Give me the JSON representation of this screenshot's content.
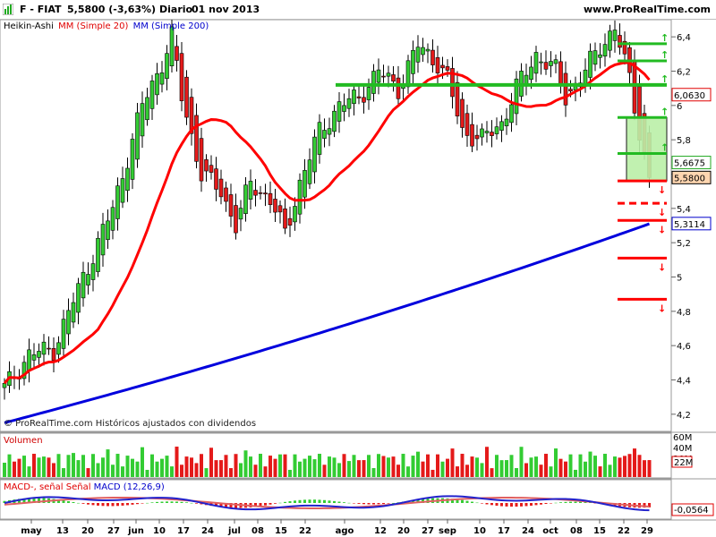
{
  "header": {
    "symbol": "F - FIAT",
    "quote": "5,5800 (-3,63%)",
    "period": "Diario",
    "date": "01 nov 2013",
    "site": "www.ProRealTime.com"
  },
  "legend": {
    "candle_type": "Heikin-Ashi",
    "ma1_label": "MM (Simple 20)",
    "ma2_label": "MM (Simple 200)"
  },
  "footnote": "© ProRealTime.com Históricos ajustados con dividendos",
  "volume_panel": {
    "title": "Volumen",
    "ticks": [
      "60M",
      "40M",
      "20M"
    ],
    "last_value_tag": "22M"
  },
  "macd_panel": {
    "title_prefix": "MACD-, señal Señal ",
    "title_params": "MACD (12,26,9)",
    "value_tag": "-0,0564"
  },
  "colors": {
    "up_candle": "#33cc33",
    "down_candle": "#e41a1a",
    "ma20": "#ff0000",
    "ma200": "#0000dd",
    "support": "#ff0000",
    "resistance": "#22bb22",
    "macd_line": "#2222cc",
    "signal_line": "#e06060"
  },
  "chart_data": {
    "type": "candlestick",
    "title": "F - FIAT",
    "y_axis": {
      "ticks": [
        "6,4",
        "6,2",
        "6",
        "5,8",
        "5,6",
        "5,4",
        "5,2",
        "5",
        "4,8",
        "4,6",
        "4,4",
        "4,2"
      ],
      "min": 4.1,
      "max": 6.5
    },
    "x_axis": {
      "labels": [
        "may",
        "13",
        "20",
        "27",
        "jun",
        "10",
        "17",
        "24",
        "jul",
        "08",
        "15",
        "22",
        "ago",
        "12",
        "20",
        "27",
        "sep",
        "10",
        "17",
        "24",
        "oct",
        "08",
        "15",
        "22",
        "29"
      ]
    },
    "price_tags": [
      {
        "label": "6,0630",
        "kind": "ma20"
      },
      {
        "label": "5,6675",
        "kind": "level"
      },
      {
        "label": "5,5800",
        "kind": "last"
      },
      {
        "label": "5,3114",
        "kind": "ma200"
      }
    ],
    "resistance_levels": [
      6.36,
      6.26,
      6.12,
      5.93,
      5.72
    ],
    "support_levels": [
      5.56,
      5.43,
      5.33,
      5.11,
      4.87
    ],
    "candles_summary": {
      "count": 132,
      "start": 4.35,
      "peak": 6.4,
      "last": 5.58
    }
  }
}
